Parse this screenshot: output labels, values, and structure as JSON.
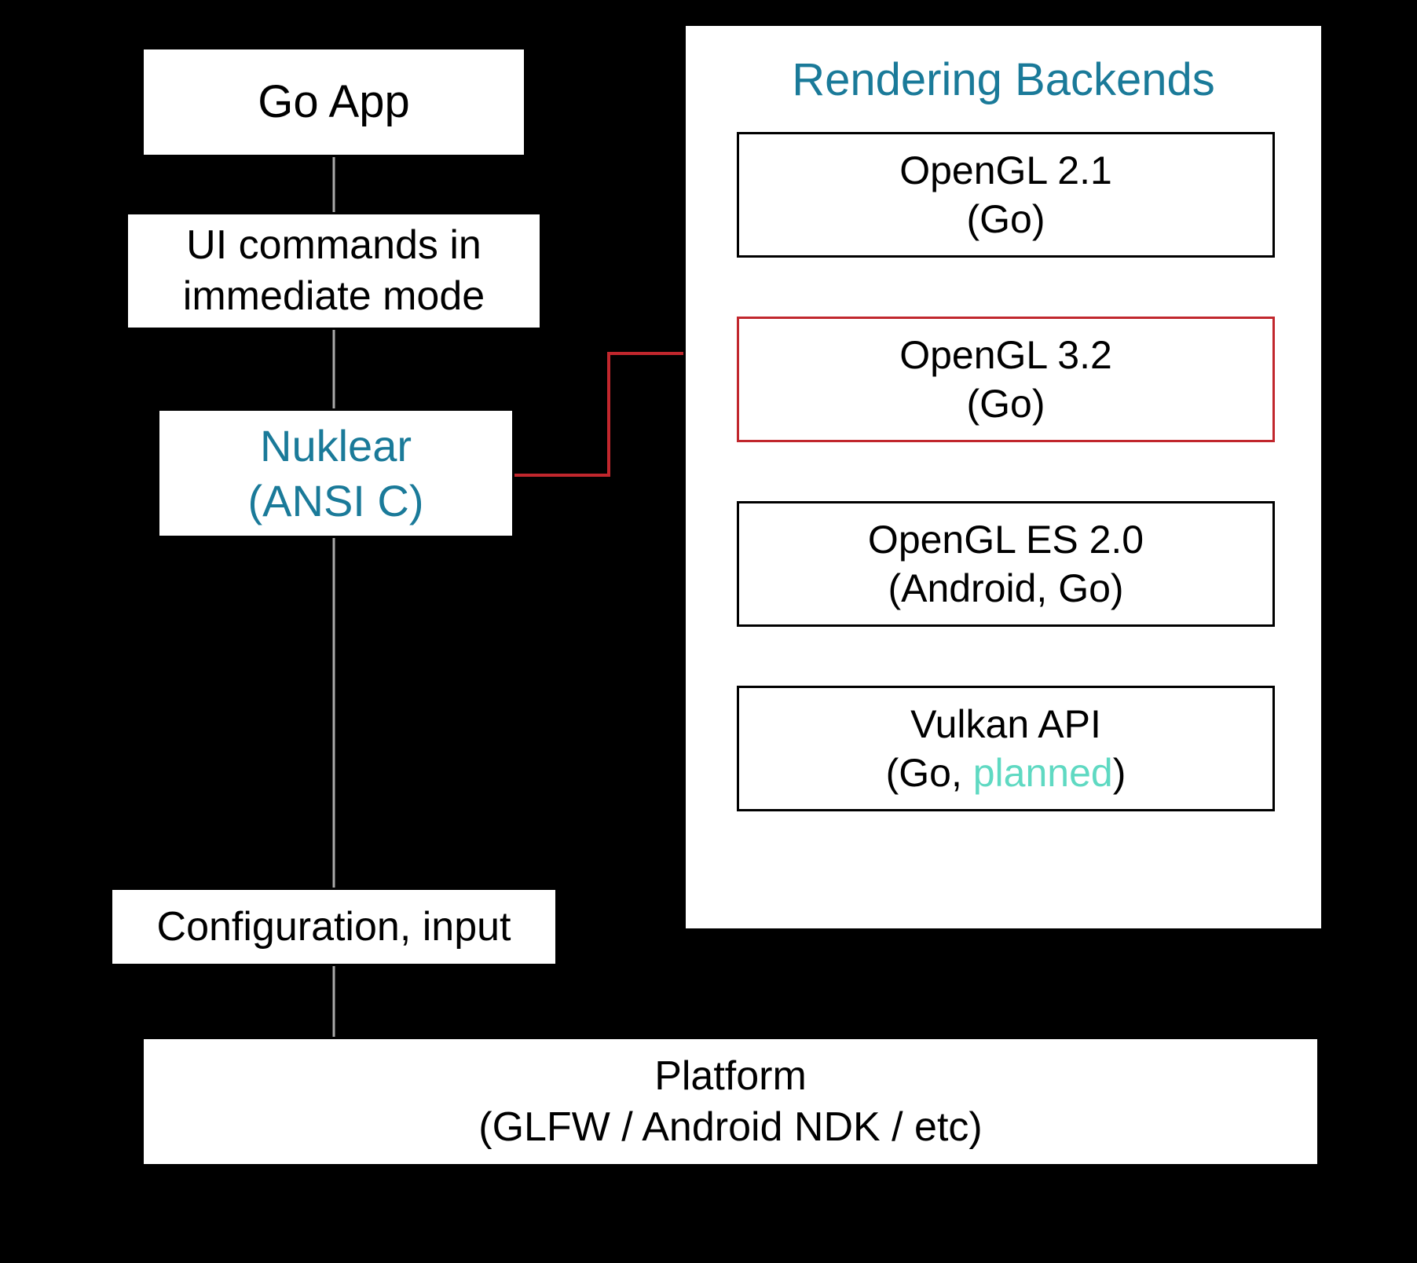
{
  "left": {
    "go_app": "Go App",
    "ui_commands_l1": "UI commands in",
    "ui_commands_l2": "immediate mode",
    "nuklear_l1": "Nuklear",
    "nuklear_l2": "(ANSI C)",
    "config_input": "Configuration, input"
  },
  "backends": {
    "title": "Rendering Backends",
    "items": [
      {
        "l1": "OpenGL 2.1",
        "l2": "(Go)"
      },
      {
        "l1": "OpenGL 3.2",
        "l2": "(Go)"
      },
      {
        "l1": "OpenGL ES 2.0",
        "l2": "(Android, Go)"
      },
      {
        "l1": "Vulkan API",
        "l2_pre": "(Go, ",
        "l2_planned": "planned",
        "l2_post": ")"
      }
    ]
  },
  "platform": {
    "l1": "Platform",
    "l2": "(GLFW / Android NDK / etc)"
  },
  "colors": {
    "teal": "#1a7a99",
    "planned": "#5fd9c2",
    "arrow": "#c1272d"
  }
}
